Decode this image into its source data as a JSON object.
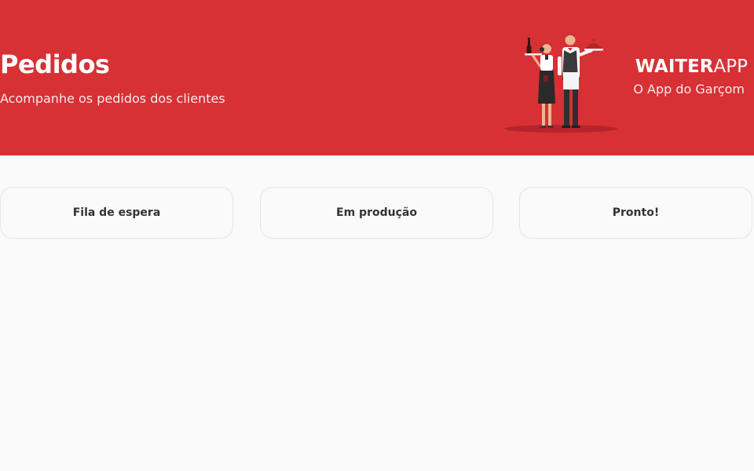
{
  "header": {
    "title": "Pedidos",
    "subtitle": "Acompanhe os pedidos dos clientes"
  },
  "brand": {
    "logo_strong": "WAITER",
    "logo_light": "APP",
    "tagline": "O App do Garçom"
  },
  "illustration": {
    "icon": "waiters-illustration-icon"
  },
  "board": {
    "columns": [
      {
        "title": "Fila de espera"
      },
      {
        "title": "Em produção"
      },
      {
        "title": "Pronto!"
      }
    ]
  },
  "colors": {
    "brand_red": "#d73035",
    "background": "#fafafa",
    "text_dark": "#333333",
    "border": "#e6e6e9"
  }
}
